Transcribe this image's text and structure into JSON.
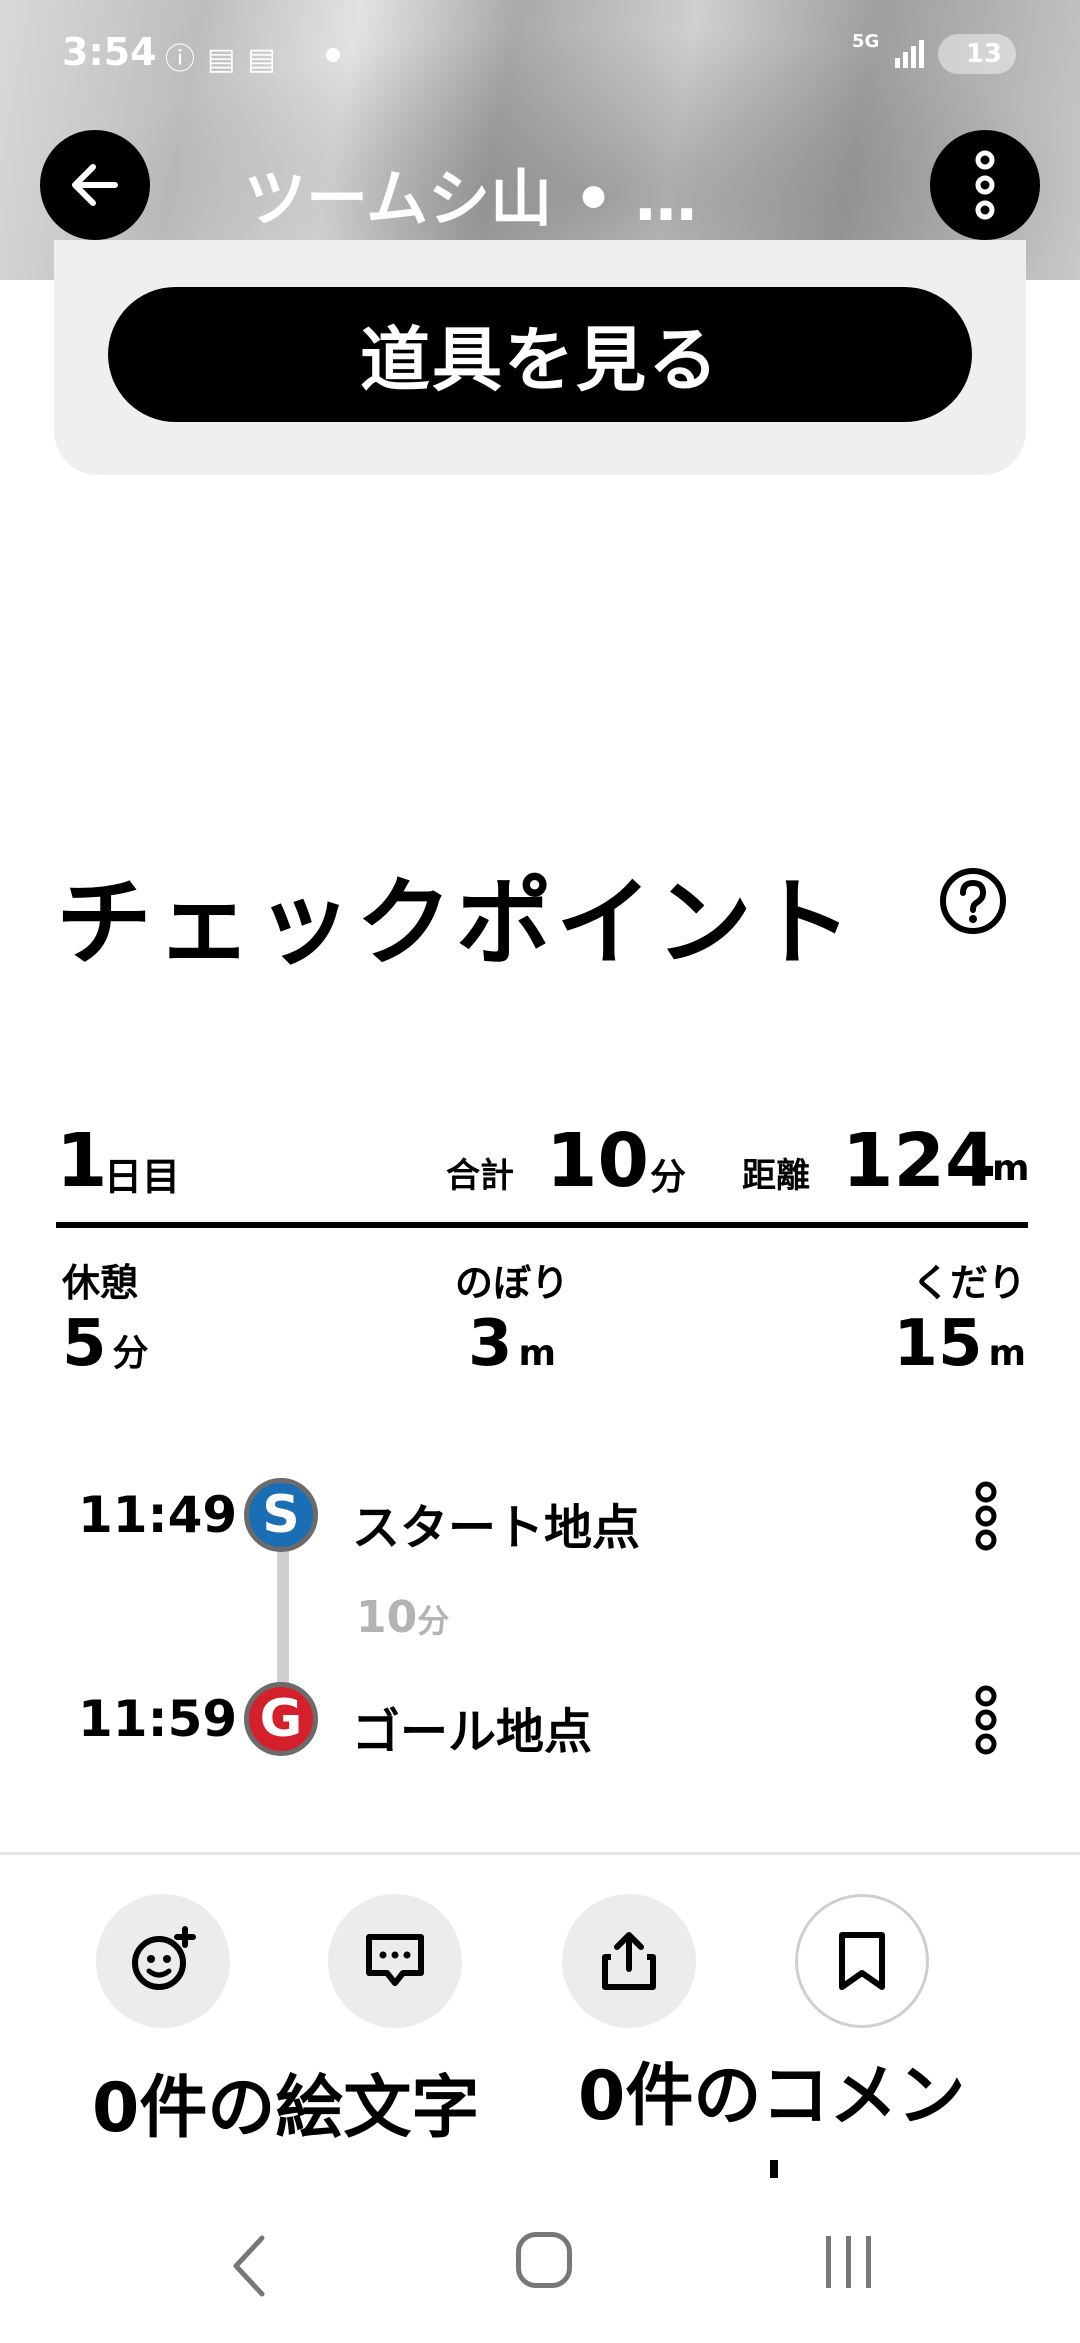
{
  "status_bar": {
    "time": "3:54",
    "network": "5G",
    "battery": "13"
  },
  "header": {
    "title": "ツームシ山 • …",
    "back_icon": "arrow-left-icon",
    "menu_icon": "more-vertical-icon"
  },
  "gear": {
    "button_label": "道具を見る"
  },
  "checkpoint": {
    "title": "チェックポイント",
    "help_icon": "question-circle-icon",
    "day": {
      "num": "1",
      "unit": "日目"
    },
    "total": {
      "label": "合計",
      "value": "10",
      "unit": "分"
    },
    "distance": {
      "label": "距離",
      "value": "124",
      "unit": "m"
    },
    "stats": {
      "rest": {
        "label": "休憩",
        "value": "5",
        "unit": "分"
      },
      "up": {
        "label": "のぼり",
        "value": "3",
        "unit": "m"
      },
      "down": {
        "label": "くだり",
        "value": "15",
        "unit": "m"
      }
    },
    "timeline": {
      "start": {
        "time": "11:49",
        "badge": "S",
        "name": "スタート地点",
        "color": "#1a6eb5"
      },
      "duration": {
        "value": "10",
        "unit": "分"
      },
      "goal": {
        "time": "11:59",
        "badge": "G",
        "name": "ゴール地点",
        "color": "#d3202a"
      }
    }
  },
  "actions": {
    "emoji_count": "0件の絵文字",
    "comment_count": "0件のコメン",
    "icons": [
      "add-emoji-icon",
      "comment-icon",
      "share-icon",
      "bookmark-icon"
    ]
  }
}
